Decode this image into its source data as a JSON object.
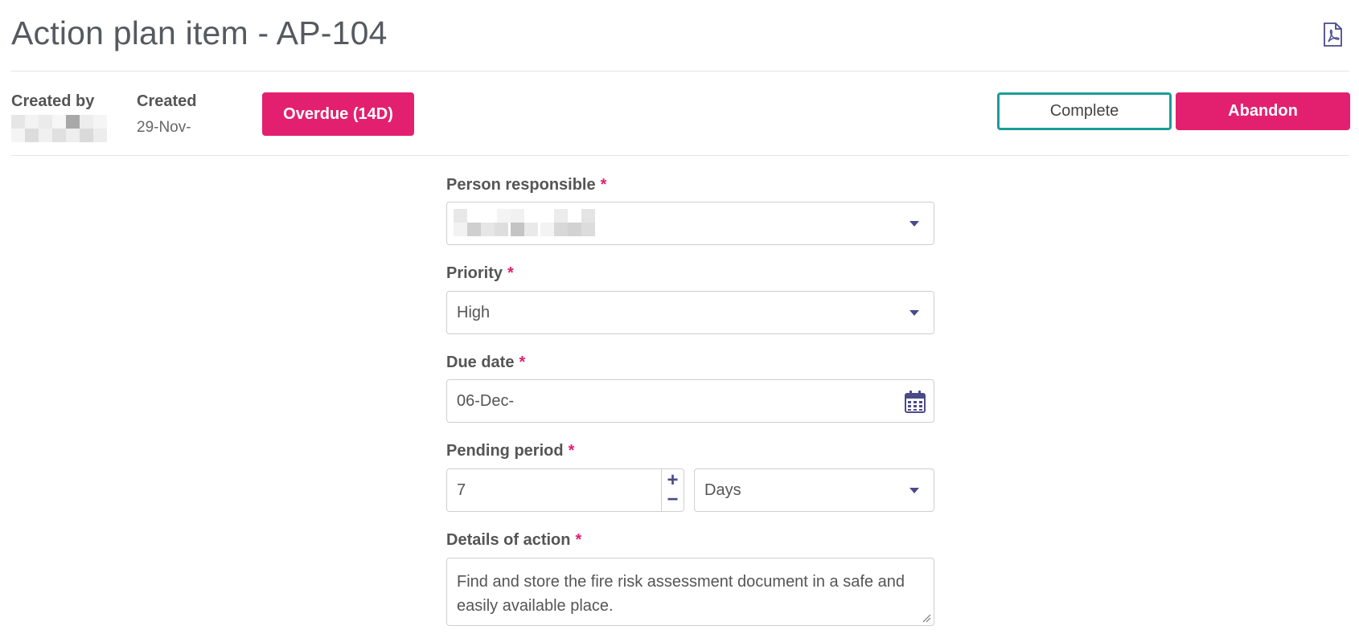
{
  "header": {
    "title": "Action plan item - AP-104",
    "pdf_icon": "pdf-icon"
  },
  "meta": {
    "created_by_label": "Created by",
    "created_label": "Created",
    "created_value": "29-Nov-"
  },
  "status": {
    "overdue_label": "Overdue (14D)"
  },
  "actions": {
    "complete_label": "Complete",
    "abandon_label": "Abandon"
  },
  "form": {
    "person_responsible": {
      "label": "Person responsible",
      "required": "*"
    },
    "priority": {
      "label": "Priority",
      "required": "*",
      "value": "High"
    },
    "due_date": {
      "label": "Due date",
      "required": "*",
      "value": "06-Dec-"
    },
    "pending_period": {
      "label": "Pending period",
      "required": "*",
      "value": "7",
      "unit": "Days",
      "plus": "+",
      "minus": "−"
    },
    "details": {
      "label": "Details of action",
      "required": "*",
      "value": "Find and store the fire risk assessment document in a safe and easily available place."
    }
  },
  "colors": {
    "accent_pink": "#e3206f",
    "accent_teal": "#1a9e96",
    "icon_purple": "#4a4a8a"
  }
}
